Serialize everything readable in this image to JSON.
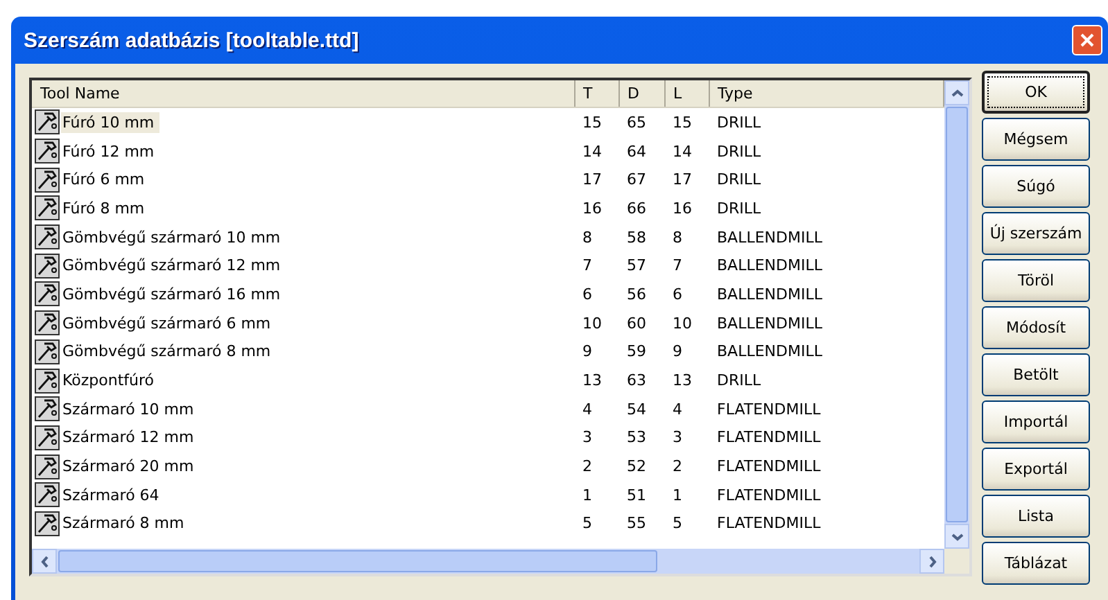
{
  "window": {
    "title": "Szerszám adatbázis [tooltable.ttd]"
  },
  "table": {
    "columns": [
      "Tool Name",
      "T",
      "D",
      "L",
      "Type"
    ],
    "rows": [
      {
        "name": "Fúró 10 mm",
        "t": "15",
        "d": "65",
        "l": "15",
        "type": "DRILL",
        "selected": true
      },
      {
        "name": "Fúró 12 mm",
        "t": "14",
        "d": "64",
        "l": "14",
        "type": "DRILL",
        "selected": false
      },
      {
        "name": "Fúró 6 mm",
        "t": "17",
        "d": "67",
        "l": "17",
        "type": "DRILL",
        "selected": false
      },
      {
        "name": "Fúró 8 mm",
        "t": "16",
        "d": "66",
        "l": "16",
        "type": "DRILL",
        "selected": false
      },
      {
        "name": "Gömbvégű szármaró 10 mm",
        "t": "8",
        "d": "58",
        "l": "8",
        "type": "BALLENDMILL",
        "selected": false
      },
      {
        "name": "Gömbvégű szármaró 12 mm",
        "t": "7",
        "d": "57",
        "l": "7",
        "type": "BALLENDMILL",
        "selected": false
      },
      {
        "name": "Gömbvégű szármaró 16 mm",
        "t": "6",
        "d": "56",
        "l": "6",
        "type": "BALLENDMILL",
        "selected": false
      },
      {
        "name": "Gömbvégű szármaró 6 mm",
        "t": "10",
        "d": "60",
        "l": "10",
        "type": "BALLENDMILL",
        "selected": false
      },
      {
        "name": "Gömbvégű szármaró 8 mm",
        "t": "9",
        "d": "59",
        "l": "9",
        "type": "BALLENDMILL",
        "selected": false
      },
      {
        "name": "Központfúró",
        "t": "13",
        "d": "63",
        "l": "13",
        "type": "DRILL",
        "selected": false
      },
      {
        "name": "Szármaró 10 mm",
        "t": "4",
        "d": "54",
        "l": "4",
        "type": "FLATENDMILL",
        "selected": false
      },
      {
        "name": "Szármaró 12 mm",
        "t": "3",
        "d": "53",
        "l": "3",
        "type": "FLATENDMILL",
        "selected": false
      },
      {
        "name": "Szármaró 20 mm",
        "t": "2",
        "d": "52",
        "l": "2",
        "type": "FLATENDMILL",
        "selected": false
      },
      {
        "name": "Szármaró 64",
        "t": "1",
        "d": "51",
        "l": "1",
        "type": "FLATENDMILL",
        "selected": false
      },
      {
        "name": "Szármaró 8 mm",
        "t": "5",
        "d": "55",
        "l": "5",
        "type": "FLATENDMILL",
        "selected": false
      }
    ]
  },
  "buttons": [
    {
      "label": "OK",
      "default": true
    },
    {
      "label": "Mégsem",
      "default": false
    },
    {
      "label": "Súgó",
      "default": false
    },
    {
      "label": "Új szerszám",
      "default": false
    },
    {
      "label": "Töröl",
      "default": false
    },
    {
      "label": "Módosít",
      "default": false
    },
    {
      "label": "Betölt",
      "default": false
    },
    {
      "label": "Importál",
      "default": false
    },
    {
      "label": "Exportál",
      "default": false
    },
    {
      "label": "Lista",
      "default": false
    },
    {
      "label": "Táblázat",
      "default": false
    }
  ]
}
